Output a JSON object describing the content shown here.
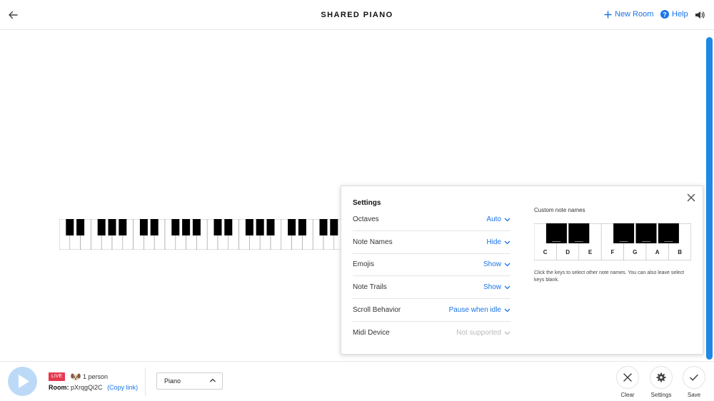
{
  "header": {
    "title": "SHARED PIANO",
    "new_room": "New Room",
    "help": "Help"
  },
  "settings": {
    "title": "Settings",
    "rows": [
      {
        "label": "Octaves",
        "value": "Auto",
        "enabled": true
      },
      {
        "label": "Note Names",
        "value": "Hide",
        "enabled": true
      },
      {
        "label": "Emojis",
        "value": "Show",
        "enabled": true
      },
      {
        "label": "Note Trails",
        "value": "Show",
        "enabled": true
      },
      {
        "label": "Scroll Behavior",
        "value": "Pause when idle",
        "enabled": true
      },
      {
        "label": "Midi Device",
        "value": "Not supported",
        "enabled": false
      }
    ],
    "custom_title": "Custom note names",
    "white_key_names": [
      "C",
      "D",
      "E",
      "F",
      "G",
      "A",
      "B"
    ],
    "black_key_names": [
      "___",
      "___",
      "___",
      "___",
      "___"
    ],
    "hint": "Click the keys to select other note names. You can also leave select keys blank."
  },
  "footer": {
    "live": "LIVE",
    "people": "1 person",
    "room_label": "Room:",
    "room_code": "pXrqgQi2C",
    "copy_link": "(Copy link)",
    "instrument": "Piano",
    "clear": "Clear",
    "settings": "Settings",
    "save": "Save"
  },
  "colors": {
    "accent": "#1a73e8",
    "live": "#e53950",
    "play": "#bcdaf7",
    "scroll": "#1e88e5"
  },
  "icons": [
    "back-arrow-icon",
    "plus-icon",
    "help-icon",
    "speaker-icon",
    "close-icon",
    "chevron-down-icon",
    "play-icon",
    "chevron-up-icon",
    "clear-icon",
    "gear-icon",
    "check-icon"
  ]
}
